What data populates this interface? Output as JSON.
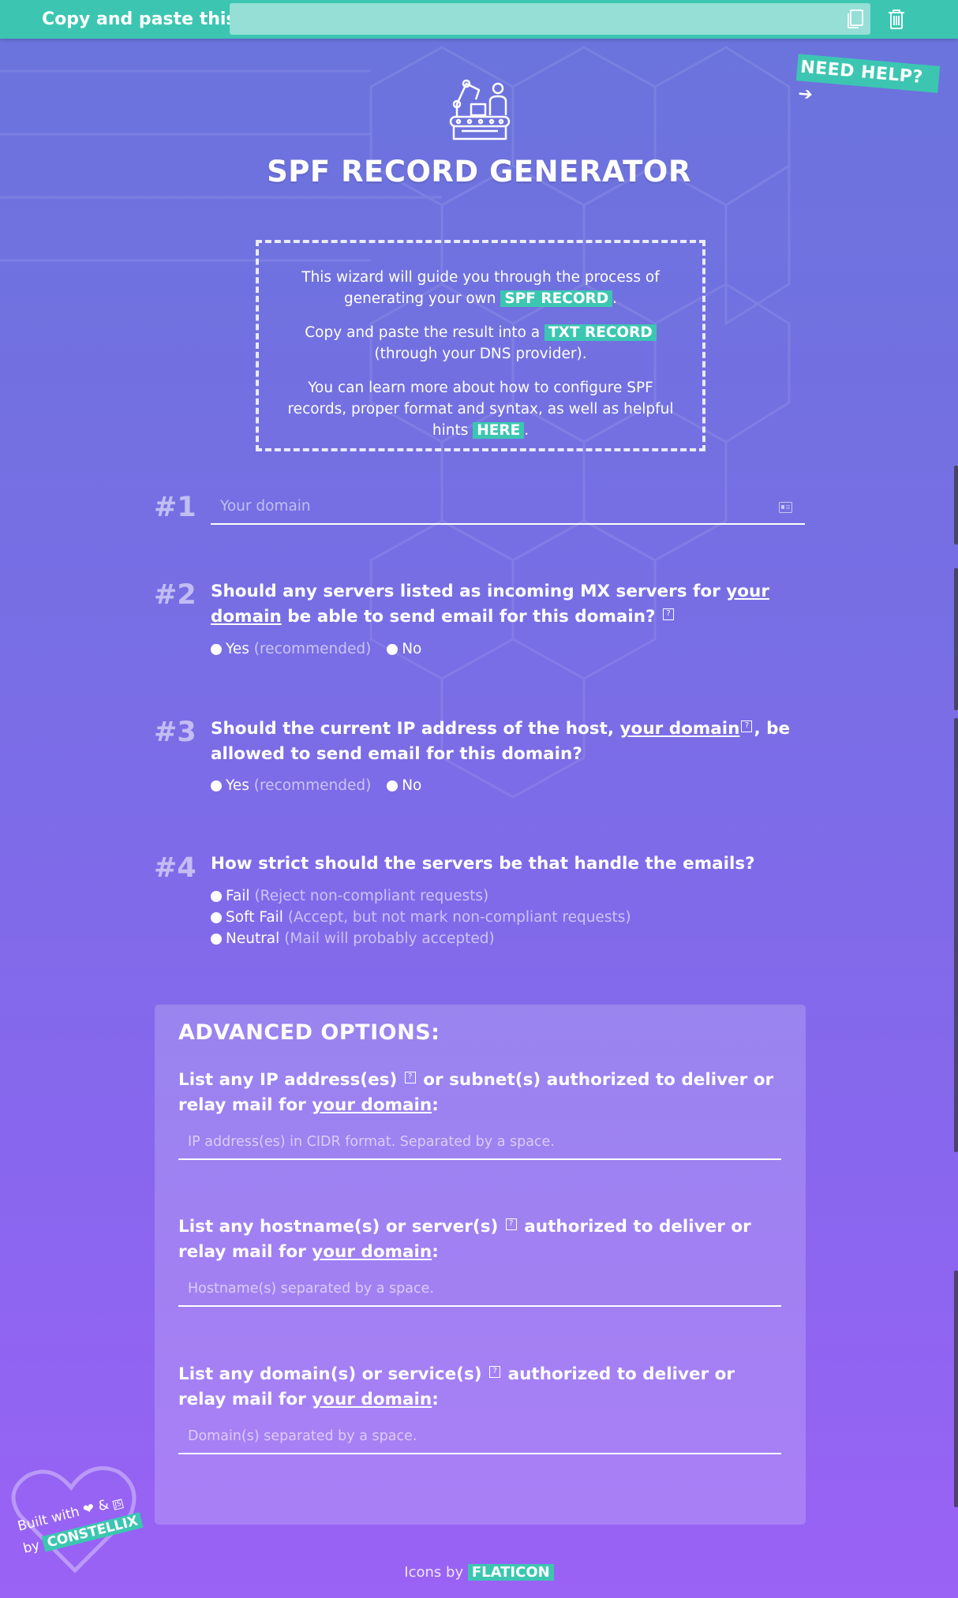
{
  "topbar": {
    "label": "Copy and paste this:",
    "value": ""
  },
  "help": {
    "label": "NEED HELP? ➔"
  },
  "title": "SPF RECORD GENERATOR",
  "intro": {
    "p1_a": "This wizard will guide you through the process of generating your own ",
    "p1_tag": "SPF RECORD",
    "p1_b": ".",
    "p2_a": "Copy and paste the result into a ",
    "p2_tag": "TXT RECORD",
    "p2_b": " (through your DNS provider).",
    "p3_a": "You can learn more about how to configure SPF records, proper format and syntax, as well as helpful hints ",
    "p3_tag": "HERE",
    "p3_b": "."
  },
  "steps": {
    "s1": {
      "num": "#1",
      "placeholder": "Your domain"
    },
    "s2": {
      "num": "#2",
      "q_a": "Should any servers listed as incoming MX servers for ",
      "q_link": "your domain",
      "q_b": " be able to send email for this domain?",
      "yes": "Yes",
      "yes_hint": "(recommended)",
      "no": "No"
    },
    "s3": {
      "num": "#3",
      "q_a": "Should the current IP address of the host, ",
      "q_link": "your domain",
      "q_b": ", be allowed to send email for this domain?",
      "yes": "Yes",
      "yes_hint": "(recommended)",
      "no": "No"
    },
    "s4": {
      "num": "#4",
      "q": "How strict should the servers be that handle the emails?",
      "options": [
        {
          "label": "Fail",
          "hint": "(Reject non-compliant requests)"
        },
        {
          "label": "Soft Fail",
          "hint": "(Accept, but not mark non-compliant requests)"
        },
        {
          "label": "Neutral",
          "hint": "(Mail will probably accepted)"
        }
      ]
    }
  },
  "advanced": {
    "title": "ADVANCED OPTIONS:",
    "ip": {
      "q_a": "List any IP address(es) ",
      "q_b": " or subnet(s) authorized to deliver or relay mail for ",
      "q_link": "your domain",
      "q_c": ":",
      "placeholder": "IP address(es) in CIDR format. Separated by a space."
    },
    "host": {
      "q_a": "List any hostname(s) or server(s) ",
      "q_b": " authorized to deliver or relay mail for ",
      "q_link": "your domain",
      "q_c": ":",
      "placeholder": "Hostname(s) separated by a space."
    },
    "domain": {
      "q_a": "List any domain(s) or service(s) ",
      "q_b": " authorized to deliver or relay mail for ",
      "q_link": "your domain",
      "q_c": ":",
      "placeholder": "Domain(s) separated by a space."
    }
  },
  "qmark": "?",
  "footer": {
    "prefix": "Icons by ",
    "tag": "FLATICON"
  },
  "badge": {
    "line1": "Built with",
    "amp": "&",
    "js": "JS",
    "line2": "by",
    "tag": "CONSTELLIX"
  },
  "colors": {
    "accent": "#3cc6b2",
    "bg_top": "#6a74dc",
    "bg_bottom": "#9a62f5"
  }
}
